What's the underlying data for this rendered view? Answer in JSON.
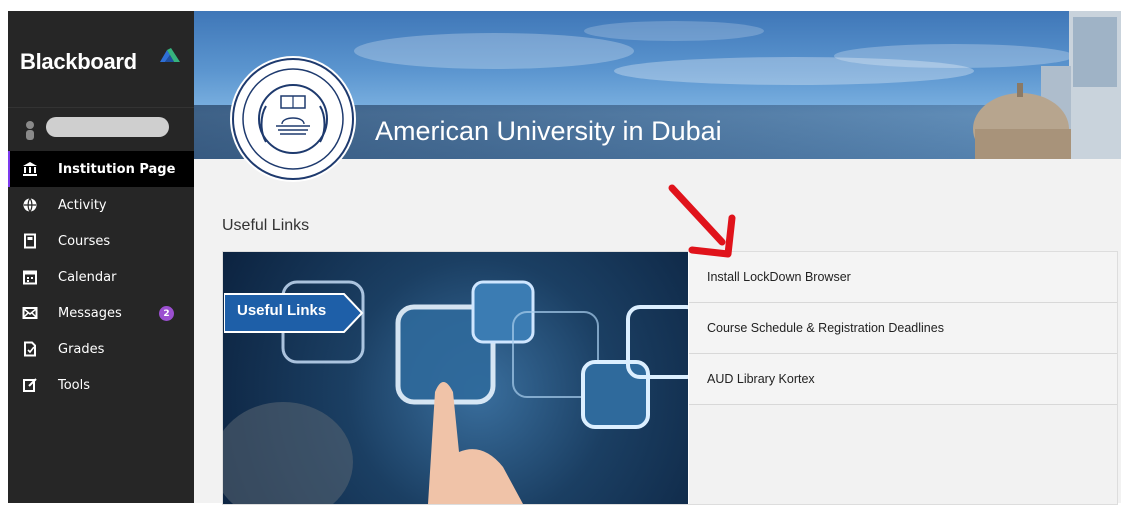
{
  "sidebar": {
    "logo_text": "Blackboard",
    "profile": {
      "avatar_icon": "user-icon"
    },
    "items": [
      {
        "label": "Institution Page",
        "icon": "institution-icon",
        "active": true
      },
      {
        "label": "Activity",
        "icon": "globe-icon"
      },
      {
        "label": "Courses",
        "icon": "courses-icon"
      },
      {
        "label": "Calendar",
        "icon": "calendar-icon"
      },
      {
        "label": "Messages",
        "icon": "envelope-icon",
        "badge": "2"
      },
      {
        "label": "Grades",
        "icon": "grades-icon"
      },
      {
        "label": "Tools",
        "icon": "tools-icon"
      }
    ],
    "colors": {
      "background": "#262626",
      "active_bg": "#000000",
      "badge": "#9b4fd0"
    }
  },
  "banner": {
    "title": "American University in Dubai"
  },
  "main": {
    "section_title": "Useful Links",
    "image_tag": "Useful Links",
    "links": [
      {
        "label": "Install LockDown Browser"
      },
      {
        "label": "Course Schedule & Registration Deadlines"
      },
      {
        "label": "AUD Library Kortex"
      }
    ]
  }
}
